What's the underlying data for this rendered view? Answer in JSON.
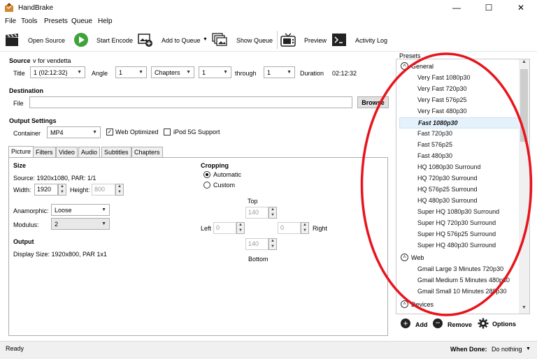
{
  "window": {
    "title": "HandBrake",
    "controls": {
      "minimize": "—",
      "maximize": "☐",
      "close": "✕"
    }
  },
  "menu": [
    "File",
    "Tools",
    "Presets",
    "Queue",
    "Help"
  ],
  "toolbar": {
    "open_source": "Open Source",
    "start_encode": "Start Encode",
    "add_to_queue": "Add to Queue",
    "show_queue": "Show Queue",
    "preview": "Preview",
    "activity_log": "Activity Log"
  },
  "source": {
    "label": "Source",
    "name": "v for vendetta",
    "title_label": "Title",
    "title_value": "1 (02:12:32)",
    "angle_label": "Angle",
    "angle_value": "1",
    "range_type": "Chapters",
    "range_start": "1",
    "through_label": "through",
    "range_end": "1",
    "duration_label": "Duration",
    "duration_value": "02:12:32"
  },
  "destination": {
    "label": "Destination",
    "file_label": "File",
    "file_value": "",
    "browse": "Browse"
  },
  "output_settings": {
    "label": "Output Settings",
    "container_label": "Container",
    "container_value": "MP4",
    "web_optimized": "Web Optimized",
    "web_optimized_checked": true,
    "ipod": "iPod 5G Support",
    "ipod_checked": false
  },
  "tabs": [
    "Picture",
    "Filters",
    "Video",
    "Audio",
    "Subtitles",
    "Chapters"
  ],
  "picture": {
    "size_label": "Size",
    "source_text": "Source:   1920x1080, PAR: 1/1",
    "width_label": "Width:",
    "width_value": "1920",
    "height_label": "Height:",
    "height_value": "800",
    "anamorphic_label": "Anamorphic:",
    "anamorphic_value": "Loose",
    "modulus_label": "Modulus:",
    "modulus_value": "2",
    "output_label": "Output",
    "display_size": "Display Size: 1920x800,  PAR 1x1",
    "cropping_label": "Cropping",
    "automatic": "Automatic",
    "custom": "Custom",
    "top_label": "Top",
    "top_value": "140",
    "left_label": "Left",
    "left_value": "0",
    "right_value": "0",
    "right_label": "Right",
    "bottom_value": "140",
    "bottom_label": "Bottom"
  },
  "presets": {
    "label": "Presets",
    "groups": [
      {
        "name": "General",
        "items": [
          "Very Fast 1080p30",
          "Very Fast 720p30",
          "Very Fast 576p25",
          "Very Fast 480p30",
          "Fast 1080p30",
          "Fast 720p30",
          "Fast 576p25",
          "Fast 480p30",
          "HQ 1080p30 Surround",
          "HQ 720p30 Surround",
          "HQ 576p25 Surround",
          "HQ 480p30 Surround",
          "Super HQ 1080p30 Surround",
          "Super HQ 720p30 Surround",
          "Super HQ 576p25 Surround",
          "Super HQ 480p30 Surround"
        ]
      },
      {
        "name": "Web",
        "items": [
          "Gmail Large 3 Minutes 720p30",
          "Gmail Medium 5 Minutes 480p30",
          "Gmail Small 10 Minutes 288p30"
        ]
      },
      {
        "name": "Devices",
        "items": []
      }
    ],
    "selected": "Fast 1080p30",
    "add": "Add",
    "remove": "Remove",
    "options": "Options"
  },
  "status": {
    "text": "Ready",
    "when_done_label": "When Done:",
    "when_done_value": "Do nothing"
  },
  "colors": {
    "annotation": "#e8141d",
    "selection": "#e5f1fb",
    "start_green": "#3fa33b"
  }
}
